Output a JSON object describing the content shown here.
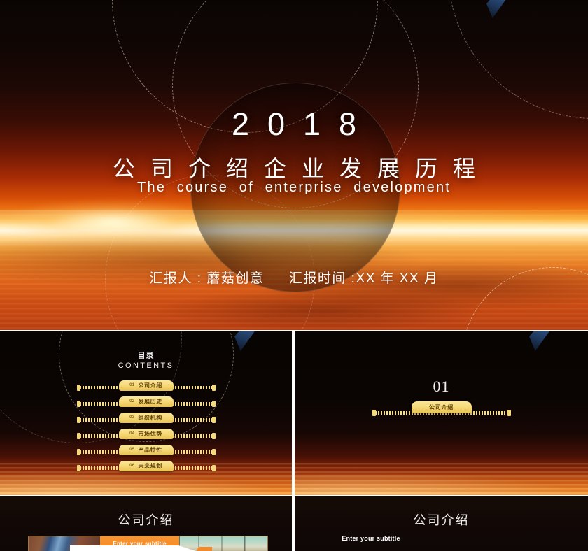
{
  "cover": {
    "year": "2018",
    "title_zh": "公司介绍企业发展历程",
    "subtitle_en": "The course of enterprise development",
    "presenter_label": "汇报人 : 蘑菇创意",
    "date_label": "汇报时间 :XX 年 XX 月"
  },
  "toc_slide": {
    "heading_zh": "目录",
    "heading_en": "CONTENTS",
    "items": [
      {
        "num": "01",
        "label": "公司介绍"
      },
      {
        "num": "02",
        "label": "发展历史"
      },
      {
        "num": "03",
        "label": "组织机构"
      },
      {
        "num": "04",
        "label": "市场优势"
      },
      {
        "num": "05",
        "label": "产品特性"
      },
      {
        "num": "06",
        "label": "未来规划"
      }
    ]
  },
  "section_slide": {
    "number": "01",
    "label": "公司介绍"
  },
  "content_slide_left": {
    "title": "公司介绍",
    "subtitle": "Enter your subtitle"
  },
  "content_slide_right": {
    "title": "公司介绍",
    "subtitle": "Enter your subtitle"
  },
  "colors": {
    "gold": "#f3d87c",
    "gold_text": "#5d3f08",
    "orange": "#f08a2c",
    "hot_core": "#fff6dd",
    "deep_red": "#b63c10",
    "night": "#0a0503"
  }
}
